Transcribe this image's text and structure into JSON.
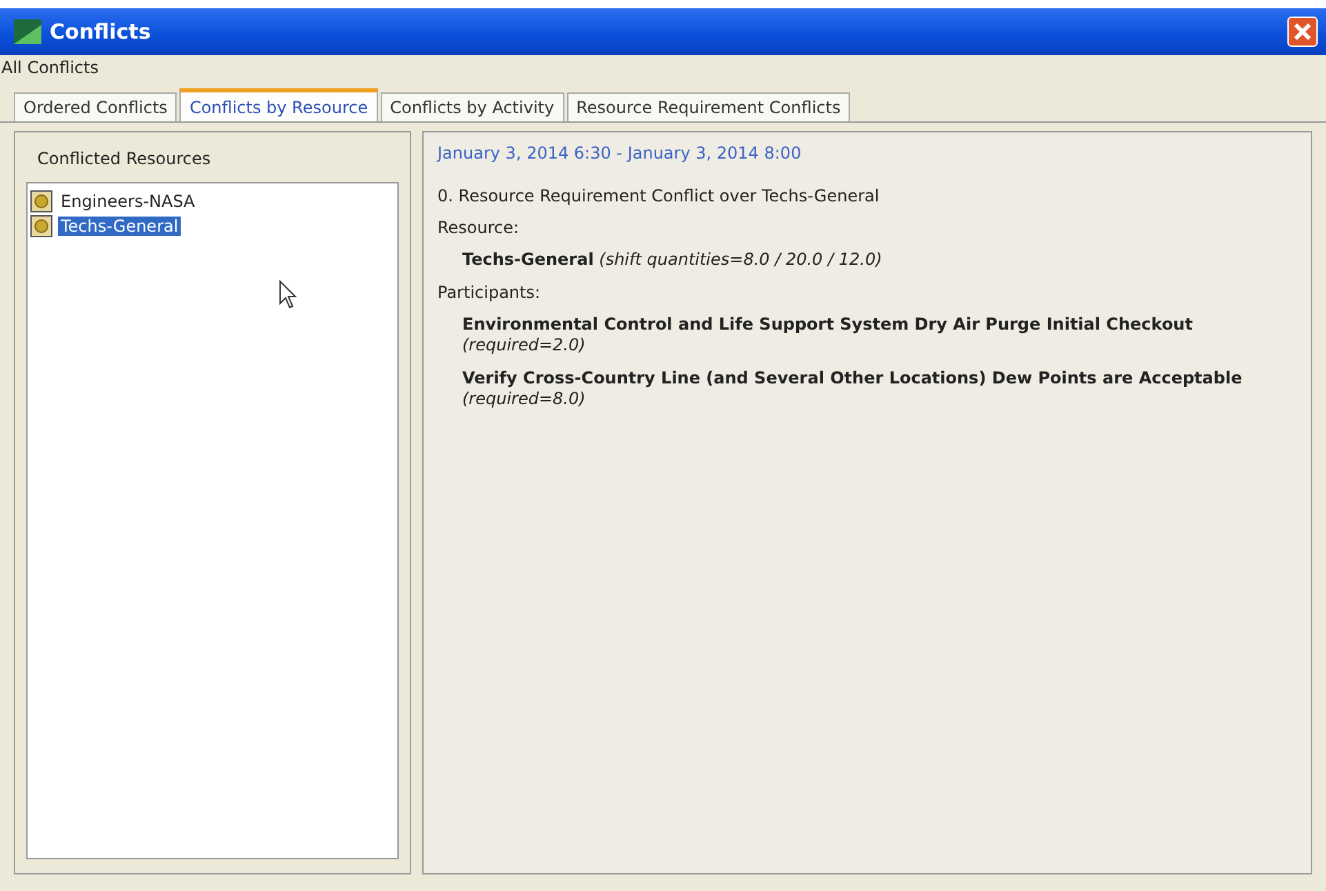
{
  "window": {
    "title": "Conflicts"
  },
  "menu": {
    "label": "All Conflicts"
  },
  "tabs": [
    {
      "label": "Ordered Conflicts",
      "selected": false
    },
    {
      "label": "Conflicts by Resource",
      "selected": true
    },
    {
      "label": "Conflicts by Activity",
      "selected": false
    },
    {
      "label": "Resource Requirement Conflicts",
      "selected": false
    }
  ],
  "sidebar": {
    "title": "Conflicted Resources",
    "items": [
      {
        "label": "Engineers-NASA",
        "selected": false
      },
      {
        "label": "Techs-General",
        "selected": true
      }
    ]
  },
  "detail": {
    "time_range": "January 3, 2014 6:30 - January 3, 2014 8:00",
    "heading": "0. Resource Requirement Conflict over Techs-General",
    "resource_label": "Resource:",
    "resource": "**Techs-General** *(shift quantities=8.0 / 20.0 / 12.0)*",
    "participants_label": "Participants:",
    "participants": [
      "**Environmental Control and Life Support System Dry Air Purge Initial Checkout** *(required=2.0)*",
      "**Verify Cross-Country Line (and Several Other Locations) Dew Points are Acceptable** *(required=8.0)*"
    ]
  }
}
